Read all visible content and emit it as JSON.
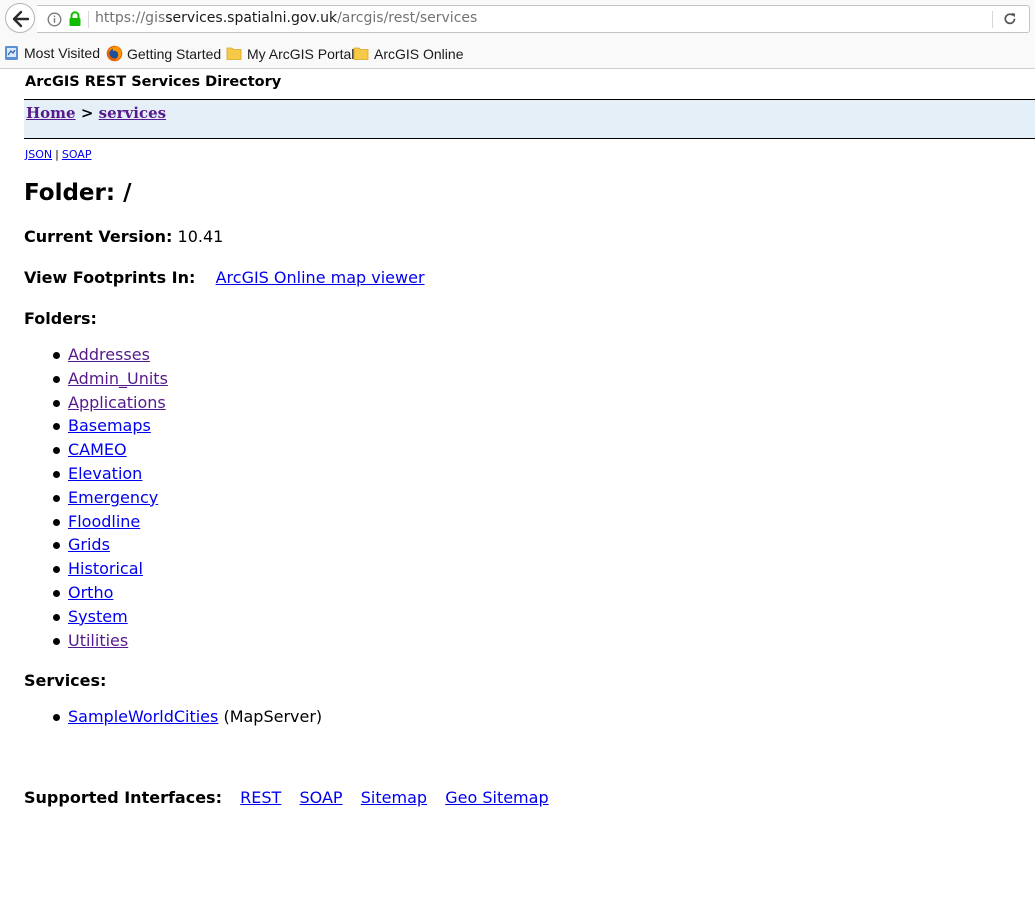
{
  "browser": {
    "url_prefix": "https://gis",
    "url_host": "services.spatialni.gov.uk",
    "url_path": "/arcgis/rest/services",
    "bookmarks": [
      "Most Visited",
      "Getting Started",
      "My ArcGIS Portal",
      "ArcGIS Online"
    ]
  },
  "page": {
    "directory_title": "ArcGIS REST Services Directory",
    "breadcrumb": {
      "home": "Home",
      "separator": ">",
      "current": "services"
    },
    "formats": {
      "json": "JSON",
      "separator": "|",
      "soap": "SOAP"
    },
    "folder_heading": "Folder: /",
    "current_version_label": "Current Version:",
    "current_version_value": "10.41",
    "footprints_label": "View Footprints In:",
    "footprints_link": "ArcGIS Online map viewer",
    "folders_label": "Folders:",
    "folders": [
      "Addresses",
      "Admin_Units",
      "Applications",
      "Basemaps",
      "CAMEO",
      "Elevation",
      "Emergency",
      "Floodline",
      "Grids",
      "Historical",
      "Ortho",
      "System",
      "Utilities"
    ],
    "services_label": "Services:",
    "services": [
      {
        "name": "SampleWorldCities",
        "type": "(MapServer)"
      }
    ],
    "interfaces_label": "Supported Interfaces:",
    "interfaces": [
      "REST",
      "SOAP",
      "Sitemap",
      "Geo Sitemap"
    ]
  }
}
